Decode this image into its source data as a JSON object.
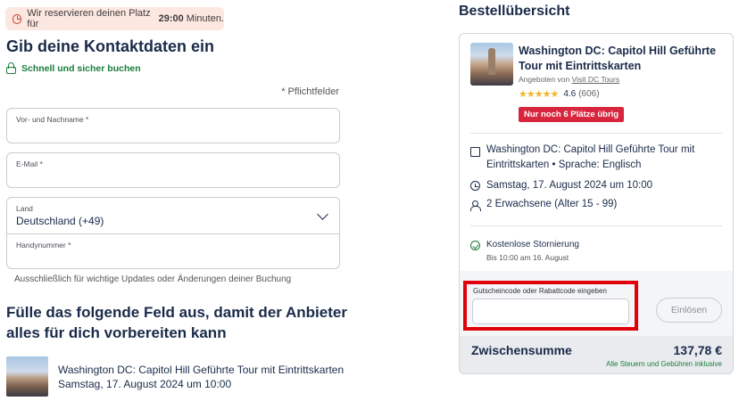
{
  "timer": {
    "text": "Wir reservieren deinen Platz für",
    "time": "29:00",
    "suffix": "Minuten."
  },
  "contact": {
    "heading": "Gib deine Kontaktdaten ein",
    "secure": "Schnell und sicher buchen",
    "required_note": "* Pflichtfelder",
    "fields": {
      "name_label": "Vor- und Nachname *",
      "email_label": "E-Mail *",
      "country_label": "Land",
      "country_value": "Deutschland (+49)",
      "phone_label": "Handynummer *"
    },
    "hint": "Ausschließlich für wichtige Updates oder Änderungen deiner Buchung"
  },
  "provider_section": {
    "heading": "Fülle das folgende Feld aus, damit der Anbieter alles für dich vorbereiten kann",
    "tour_title": "Washington DC: Capitol Hill Geführte Tour mit Eintrittskarten",
    "tour_date": "Samstag, 17. August 2024 um 10:00"
  },
  "order": {
    "heading": "Bestellübersicht",
    "title": "Washington DC: Capitol Hill Geführte Tour mit Eintrittskarten",
    "offered_by": "Angeboten von",
    "provider": "Visit DC Tours",
    "stars": "★★★★★",
    "rating": "4.6",
    "reviews": "(606)",
    "badge": "Nur noch 6 Plätze übrig",
    "detail_tour": "Washington DC: Capitol Hill Geführte Tour mit Eintrittskarten • Sprache: Englisch",
    "detail_date": "Samstag, 17. August 2024 um 10:00",
    "detail_people": "2 Erwachsene (Alter 15 - 99)",
    "cancel": "Kostenlose Stornierung",
    "cancel_sub": "Bis 10:00 am 16. August",
    "voucher_label": "Gutscheincode oder Rabattcode eingeben",
    "redeem": "Einlösen",
    "subtotal_label": "Zwischensumme",
    "subtotal_value": "137,78 €",
    "subtotal_note": "Alle Steuern und Gebühren inklusive"
  }
}
